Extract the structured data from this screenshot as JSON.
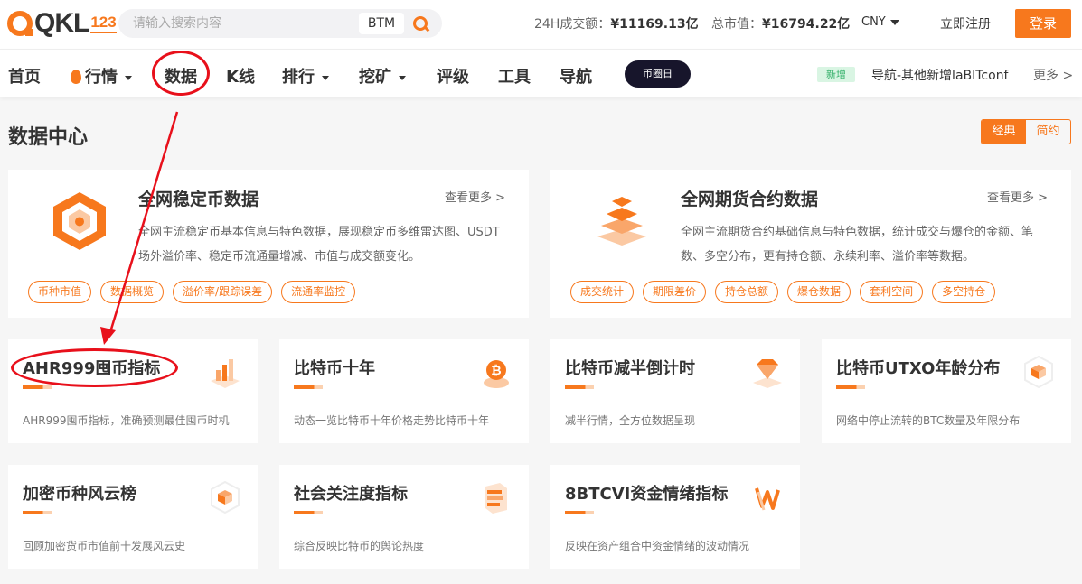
{
  "header": {
    "logo_text": "QKL",
    "logo_num": "123",
    "search_placeholder": "请输入搜索内容",
    "search_tag": "BTM",
    "volume_label": "24H成交额：",
    "volume_value": "¥11169.13亿",
    "mcap_label": "总市值：",
    "mcap_value": "¥16794.22亿",
    "currency": "CNY",
    "register": "立即注册",
    "login": "登录"
  },
  "nav": {
    "items": [
      "首页",
      "行情",
      "数据",
      "K线",
      "排行",
      "挖矿",
      "评级",
      "工具",
      "导航"
    ],
    "promo": "币圈日",
    "new_badge": "新增",
    "news": "导航-其他新增laBITconf",
    "more": "更多 >"
  },
  "main": {
    "title": "数据中心",
    "toggle": [
      "经典",
      "简约"
    ]
  },
  "big_cards": [
    {
      "title": "全网稳定币数据",
      "more": "查看更多 >",
      "desc": "全网主流稳定币基本信息与特色数据，展现稳定币多维雷达图、USDT场外溢价率、稳定币流通量增减、市值与成交额变化。",
      "tags": [
        "币种市值",
        "数据概览",
        "溢价率/跟踪误差",
        "流通率监控"
      ]
    },
    {
      "title": "全网期货合约数据",
      "more": "查看更多 >",
      "desc": "全网主流期货合约基础信息与特色数据，统计成交与爆仓的金额、笔数、多空分布，更有持仓额、永续利率、溢价率等数据。",
      "tags": [
        "成交统计",
        "期限差价",
        "持仓总额",
        "爆仓数据",
        "套利空间",
        "多空持仓"
      ]
    }
  ],
  "cards": [
    {
      "title": "AHR999囤币指标",
      "desc": "AHR999囤币指标，准确预测最佳囤币时机"
    },
    {
      "title": "比特币十年",
      "desc": "动态一览比特币十年价格走势比特币十年"
    },
    {
      "title": "比特币减半倒计时",
      "desc": "减半行情，全方位数据呈现"
    },
    {
      "title": "比特币UTXO年龄分布",
      "desc": "网络中停止流转的BTC数量及年限分布"
    },
    {
      "title": "加密币种风云榜",
      "desc": "回顾加密货币市值前十发展风云史"
    },
    {
      "title": "社会关注度指标",
      "desc": "综合反映比特币的舆论热度"
    },
    {
      "title": "8BTCVI资金情绪指标",
      "desc": "反映在资产组合中资金情绪的波动情况"
    }
  ],
  "colors": {
    "accent": "#f7781d",
    "annotation": "#e8101b"
  }
}
